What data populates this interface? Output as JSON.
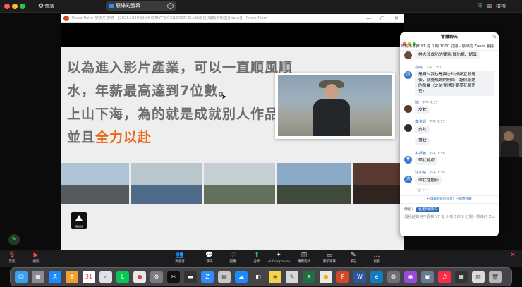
{
  "topbar": {
    "left_icon_label": "會議",
    "share_label": "懸綠的螢幕",
    "right_label": "檢視"
  },
  "powerpoint": {
    "title_text": "PowerPoint 放映片放映 - [20251029如何不靠推YT從0到1000訂閱上出版社(鐵鐵資訊園)(pptx)] - PowerPoint"
  },
  "slide": {
    "line1": "以為進入影片產業，可以一直順風順",
    "line2": "水，年薪最高達到7位數。",
    "line3": "上山下海，為的就是成就別人作品，",
    "line4_prefix": "並且",
    "line4_highlight": "全力以赴",
    "logo_caption": "鐵鐵資訊"
  },
  "chat": {
    "title": "會議聊天",
    "subtitle": "如何不靠推 YT 從 0 到 1000 訂閱 - 懸綠的 Zoom 會議",
    "messages": [
      {
        "name": "",
        "time": "",
        "text": "林志玲成功的要素:做功課、認真",
        "avatar": "",
        "avatar_color": "#6b4a3a"
      },
      {
        "name": "加薪",
        "time": "下午 7:57",
        "text_lines": [
          "是啊～我也是與志玲姊姊互動過",
          "後，就覺成她的粉絲，超佩服她",
          "的敬業（之前覺得是美美花瓶而",
          "已）"
        ],
        "avatar": "加",
        "avatar_color": "#3a78c9"
      },
      {
        "name": "戀",
        "time": "下午 7:57",
        "text": "皮蛇",
        "avatar": "",
        "avatar_color": "#5a3a2a"
      },
      {
        "name": "莫金運",
        "time": "下午 7:57",
        "text": "皮蛇",
        "text2": "帶狀",
        "avatar": "",
        "avatar_color": "#3a3a3a"
      },
      {
        "name": "林武義",
        "time": "下午 7:58",
        "text": "帶狀皰疹",
        "avatar": "林",
        "avatar_color": "#3a78c9"
      },
      {
        "name": "洪小蘋",
        "time": "下午 7:58",
        "text": "帶狀性皰疹",
        "avatar": "洪",
        "avatar_color": "#3a78c9"
      }
    ],
    "unread_label": "已讀取到您的訊息！已開始移動",
    "to_label": "傳給：",
    "to_target": "會議群組聊天",
    "input_text": "傳訊給如何不靠推 YT 從 0 到 1000 訂閱 - 懸綠的 Zo..."
  },
  "toolbar": {
    "items": [
      {
        "icon": "mic-muted-icon",
        "glyph": "🎙",
        "label": "音訊"
      },
      {
        "icon": "video-off-icon",
        "glyph": "▶",
        "label": "視訊"
      },
      {
        "icon": "participants-icon",
        "glyph": "👥",
        "label": "與會者",
        "count": "100"
      },
      {
        "icon": "chat-icon",
        "glyph": "💬",
        "label": "聊天"
      },
      {
        "icon": "reactions-icon",
        "glyph": "♡",
        "label": "回應"
      },
      {
        "icon": "share-icon",
        "glyph": "⬆",
        "label": "分享"
      },
      {
        "icon": "ai-companion-icon",
        "glyph": "✦",
        "label": "AI Companion"
      },
      {
        "icon": "apps-icon",
        "glyph": "◫",
        "label": "應用程式",
        "count": "4"
      },
      {
        "icon": "view-icon",
        "glyph": "▭",
        "label": "顯示字幕"
      },
      {
        "icon": "notes-icon",
        "glyph": "✎",
        "label": "筆記"
      },
      {
        "icon": "more-icon",
        "glyph": "…",
        "label": "更多"
      }
    ]
  },
  "dock": {
    "icons": [
      {
        "name": "finder-icon",
        "color": "#3aa0f0",
        "glyph": "☺"
      },
      {
        "name": "launchpad-icon",
        "color": "#8b8b96",
        "glyph": "▦"
      },
      {
        "name": "appstore-icon",
        "color": "#1a8cff",
        "glyph": "A"
      },
      {
        "name": "photos-icon",
        "color": "#f0a030",
        "glyph": "✿"
      },
      {
        "name": "calendar-icon",
        "color": "#ffffff",
        "glyph": "31",
        "fg": "#e33"
      },
      {
        "name": "safari-icon",
        "color": "#e0e0e6",
        "glyph": "✓",
        "fg": "#1a8cff"
      },
      {
        "name": "line-icon",
        "color": "#06c755",
        "glyph": "L"
      },
      {
        "name": "chrome-icon",
        "color": "#e8e8e8",
        "glyph": "●",
        "fg": "#db4437"
      },
      {
        "name": "settings-icon",
        "color": "#7a7a80",
        "glyph": "⚙"
      },
      {
        "name": "capcut-icon",
        "color": "#111",
        "glyph": "✂"
      },
      {
        "name": "notes-app-icon",
        "color": "#333",
        "glyph": "▬"
      },
      {
        "name": "zoom-icon",
        "color": "#2d8cff",
        "glyph": "Z"
      },
      {
        "name": "finder2-icon",
        "color": "#c8c8c8",
        "glyph": "▤",
        "fg": "#333"
      },
      {
        "name": "onedrive-icon",
        "color": "#1a8cff",
        "glyph": "☁"
      },
      {
        "name": "generic-icon",
        "color": "#444",
        "glyph": "◧"
      },
      {
        "name": "notes-yellow-icon",
        "color": "#f5d44a",
        "glyph": "≡",
        "fg": "#333"
      },
      {
        "name": "textedit-icon",
        "color": "#d8d8d8",
        "glyph": "✎",
        "fg": "#333"
      },
      {
        "name": "excel-icon",
        "color": "#1d6f42",
        "glyph": "X"
      },
      {
        "name": "chrome2-icon",
        "color": "#e8e8e8",
        "glyph": "●",
        "fg": "#f4b400"
      },
      {
        "name": "powerpoint-icon",
        "color": "#d24726",
        "glyph": "P"
      },
      {
        "name": "word-icon",
        "color": "#2b579a",
        "glyph": "W"
      },
      {
        "name": "edge-icon",
        "color": "#0f7cc4",
        "glyph": "e"
      },
      {
        "name": "gear2-icon",
        "color": "#6f6f75",
        "glyph": "⚙"
      },
      {
        "name": "podcast-icon",
        "color": "#9a4ad9",
        "glyph": "◉"
      },
      {
        "name": "preview-icon",
        "color": "#6a7a90",
        "glyph": "▣"
      },
      {
        "name": "music-icon",
        "color": "#fa2d48",
        "glyph": "♫"
      },
      {
        "name": "calculator-icon",
        "color": "#333",
        "glyph": "▦"
      },
      {
        "name": "photo-app-icon",
        "color": "#dcdcdc",
        "glyph": "▨",
        "fg": "#555"
      },
      {
        "name": "trash-icon",
        "color": "#b8b8bc",
        "glyph": "🗑",
        "fg": "#333"
      }
    ]
  }
}
